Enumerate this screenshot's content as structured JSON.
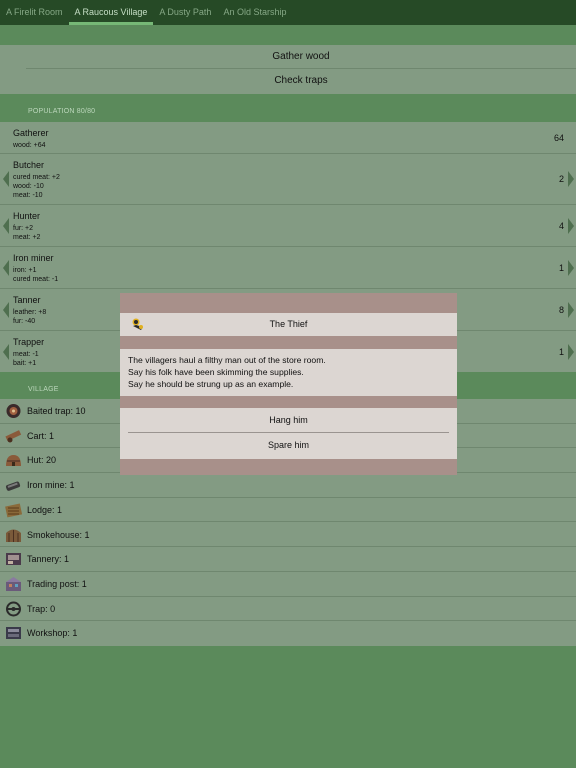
{
  "tabs": [
    {
      "label": "A Firelit Room",
      "active": false
    },
    {
      "label": "A Raucous Village",
      "active": true
    },
    {
      "label": "A Dusty Path",
      "active": false
    },
    {
      "label": "An Old Starship",
      "active": false
    }
  ],
  "actions": {
    "gather_wood": "Gather wood",
    "check_traps": "Check traps"
  },
  "population": {
    "header": "POPULATION 80/80",
    "rows": [
      {
        "name": "Gatherer",
        "stats": [
          "wood: +64"
        ],
        "count": "64",
        "left_arrow": false,
        "right_arrow": false
      },
      {
        "name": "Butcher",
        "stats": [
          "cured meat: +2",
          "wood: -10",
          "meat: -10"
        ],
        "count": "2",
        "left_arrow": true,
        "right_arrow": true
      },
      {
        "name": "Hunter",
        "stats": [
          "fur: +2",
          "meat: +2"
        ],
        "count": "4",
        "left_arrow": true,
        "right_arrow": true
      },
      {
        "name": "Iron miner",
        "stats": [
          "iron: +1",
          "cured meat: -1"
        ],
        "count": "1",
        "left_arrow": true,
        "right_arrow": true
      },
      {
        "name": "Tanner",
        "stats": [
          "leather: +8",
          "fur: -40"
        ],
        "count": "8",
        "left_arrow": true,
        "right_arrow": true
      },
      {
        "name": "Trapper",
        "stats": [
          "meat: -1",
          "bait: +1"
        ],
        "count": "1",
        "left_arrow": true,
        "right_arrow": true
      }
    ]
  },
  "village": {
    "header": "VILLAGE",
    "items": [
      {
        "label": "Baited trap: 10",
        "icon": "baited-trap-icon",
        "color": "#6a4a3a"
      },
      {
        "label": "Cart: 1",
        "icon": "cart-icon",
        "color": "#8a5a3a"
      },
      {
        "label": "Hut: 20",
        "icon": "hut-icon",
        "color": "#7a5a4a"
      },
      {
        "label": "Iron mine: 1",
        "icon": "iron-mine-icon",
        "color": "#4a4a4a"
      },
      {
        "label": "Lodge: 1",
        "icon": "lodge-icon",
        "color": "#8a6a3a"
      },
      {
        "label": "Smokehouse: 1",
        "icon": "smokehouse-icon",
        "color": "#7a5a3a"
      },
      {
        "label": "Tannery: 1",
        "icon": "tannery-icon",
        "color": "#5a4a5a"
      },
      {
        "label": "Trading post: 1",
        "icon": "trading-post-icon",
        "color": "#6a5a7a"
      },
      {
        "label": "Trap: 0",
        "icon": "trap-icon",
        "color": "#3a3a3a"
      },
      {
        "label": "Workshop: 1",
        "icon": "workshop-icon",
        "color": "#4a4a5a"
      }
    ]
  },
  "modal": {
    "title": "The Thief",
    "icon": "thief-icon",
    "body": [
      "The villagers haul a filthy man out of the store room.",
      "Say his folk have been skimming the supplies.",
      "Say he should be strung up as an example."
    ],
    "buttons": [
      "Hang him",
      "Spare him"
    ]
  }
}
